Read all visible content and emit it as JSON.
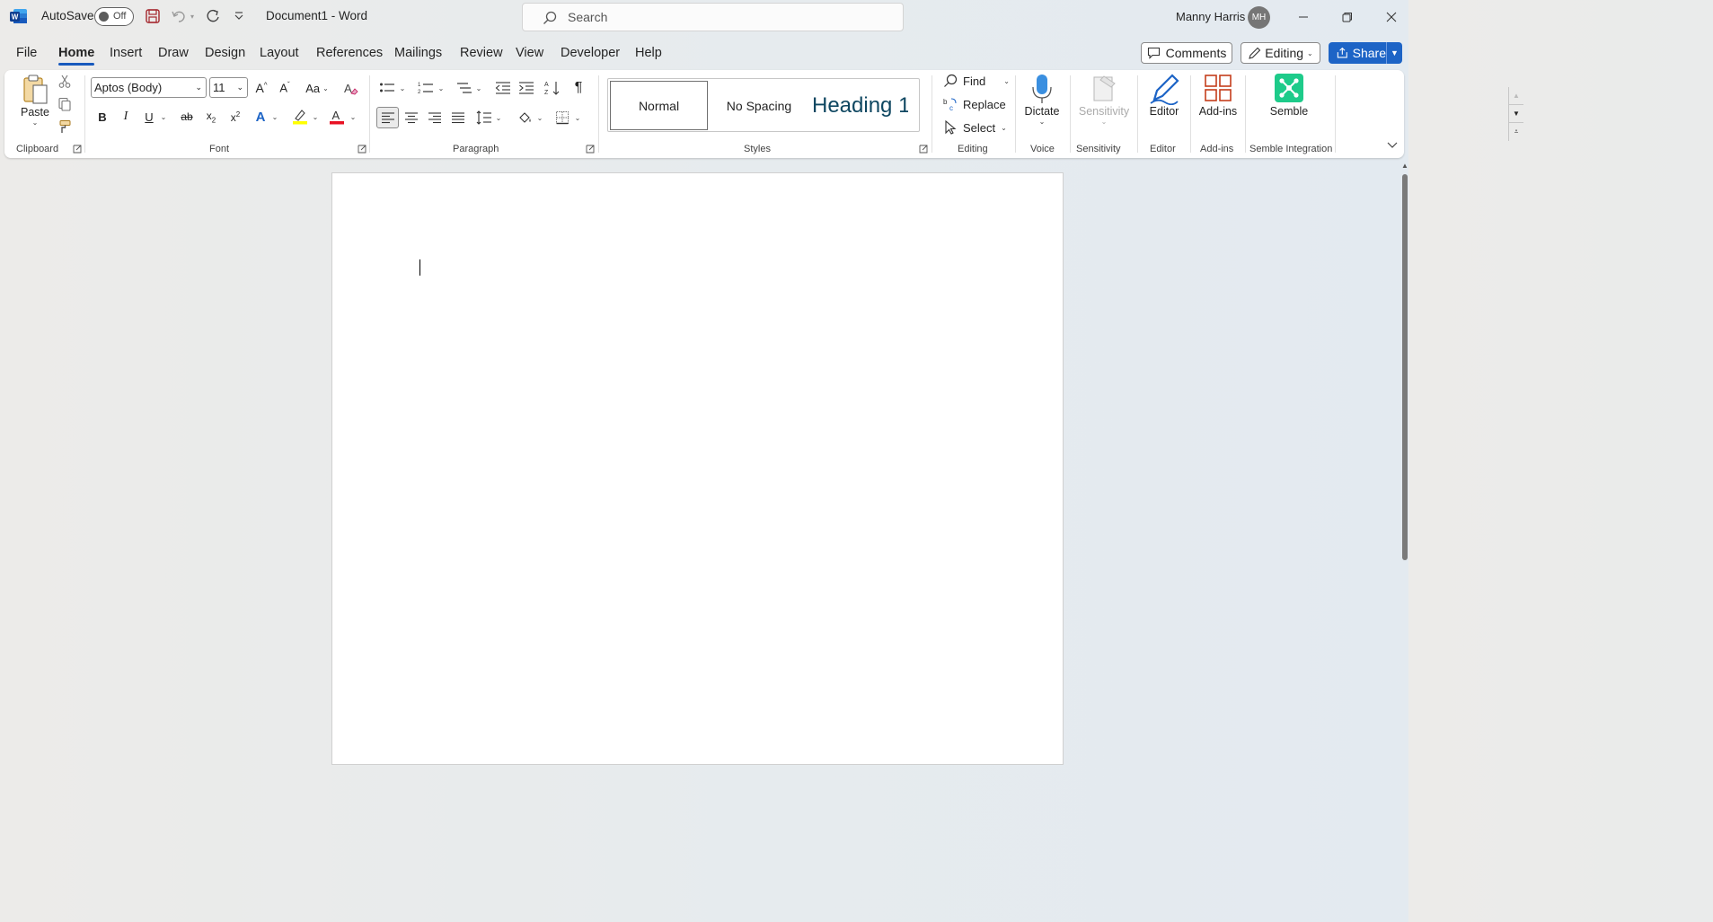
{
  "titlebar": {
    "autosave_label": "AutoSave",
    "autosave_state": "Off",
    "doc_title": "Document1  -  Word",
    "search_placeholder": "Search",
    "user_name": "Manny Harris",
    "user_initials": "MH"
  },
  "tabs": [
    "File",
    "Home",
    "Insert",
    "Draw",
    "Design",
    "Layout",
    "References",
    "Mailings",
    "Review",
    "View",
    "Developer",
    "Help"
  ],
  "active_tab": "Home",
  "right_buttons": {
    "comments": "Comments",
    "editing": "Editing",
    "share": "Share"
  },
  "ribbon": {
    "clipboard": {
      "label": "Clipboard",
      "paste": "Paste"
    },
    "font": {
      "label": "Font",
      "font_name": "Aptos (Body)",
      "font_size": "11",
      "change_case": "Aa"
    },
    "paragraph": {
      "label": "Paragraph"
    },
    "styles": {
      "label": "Styles",
      "items": [
        "Normal",
        "No Spacing",
        "Heading 1"
      ]
    },
    "editing": {
      "label": "Editing",
      "find": "Find",
      "replace": "Replace",
      "select": "Select"
    },
    "voice": {
      "label": "Voice",
      "dictate": "Dictate"
    },
    "sensitivity": {
      "label": "Sensitivity",
      "button": "Sensitivity"
    },
    "editor": {
      "label": "Editor",
      "button": "Editor"
    },
    "addins": {
      "label": "Add-ins",
      "button": "Add-ins"
    },
    "semble": {
      "label": "Semble Integration",
      "button": "Semble"
    }
  },
  "colors": {
    "accent": "#185abd",
    "share_bg": "#1d64c6",
    "semble_green": "#1ecb8a",
    "highlight_yellow": "#ffff00",
    "font_red": "#e81123"
  }
}
